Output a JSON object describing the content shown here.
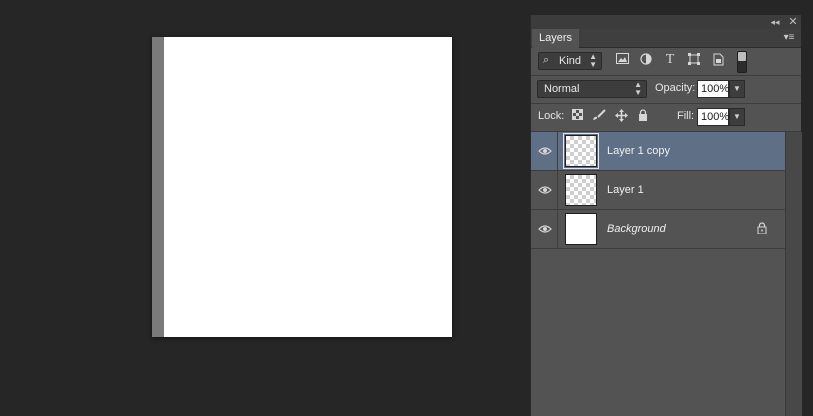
{
  "panel": {
    "tab_label": "Layers",
    "collapse_glyph": "◂◂",
    "close_glyph": "✕",
    "menu_glyph": "▾≡"
  },
  "filter": {
    "kind_label": "Kind",
    "icons": [
      "image-filter-icon",
      "adjustment-filter-icon",
      "type-filter-icon",
      "shape-filter-icon",
      "smart-object-filter-icon"
    ]
  },
  "blend": {
    "mode": "Normal",
    "opacity_label": "Opacity:",
    "opacity_value": "100%"
  },
  "lock": {
    "lock_label": "Lock:",
    "fill_label": "Fill:",
    "fill_value": "100%"
  },
  "layers": [
    {
      "name": "Layer 1 copy",
      "selected": true,
      "transparent": true,
      "locked": false
    },
    {
      "name": "Layer 1",
      "selected": false,
      "transparent": true,
      "locked": false
    },
    {
      "name": "Background",
      "selected": false,
      "transparent": false,
      "locked": true
    }
  ]
}
